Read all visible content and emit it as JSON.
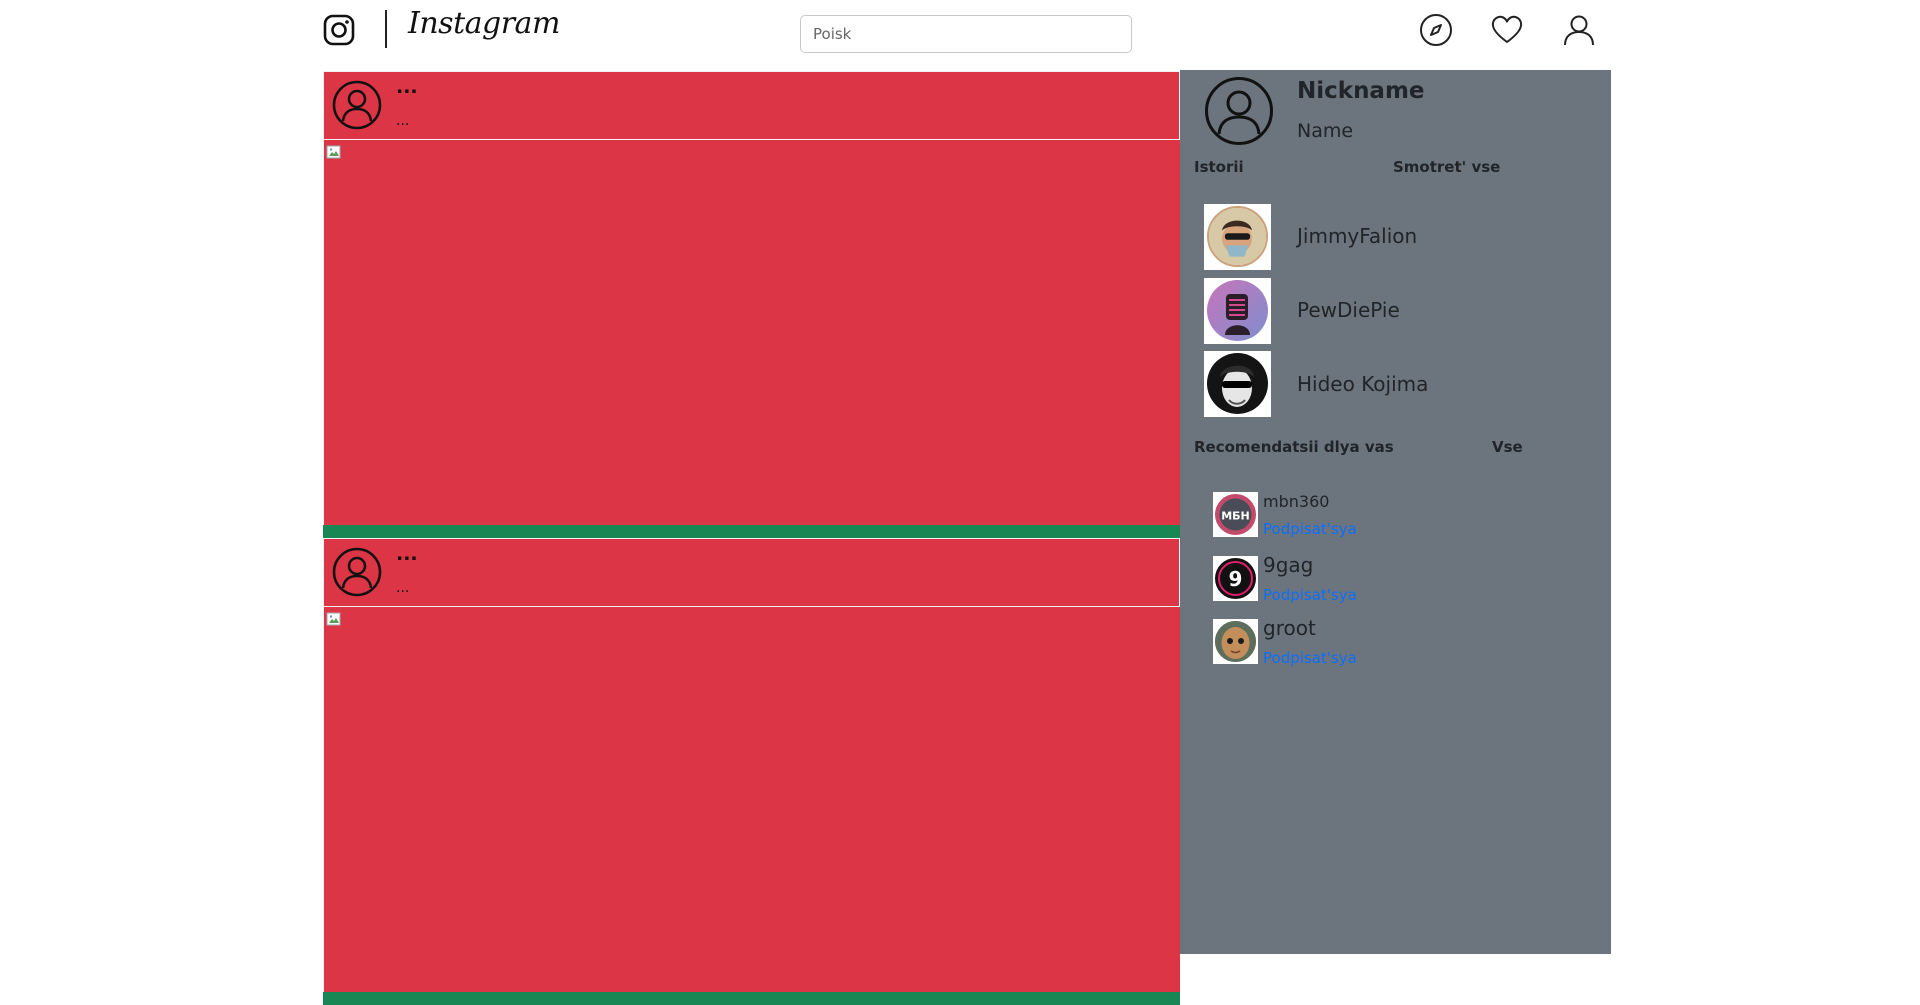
{
  "header": {
    "logo_text": "Instagram",
    "search_placeholder": "Poisk",
    "icons": [
      "instagram-glyph-icon",
      "compass-icon",
      "heart-icon",
      "user-icon"
    ]
  },
  "posts": [
    {
      "username": "...",
      "location": "..."
    },
    {
      "username": "...",
      "location": "..."
    }
  ],
  "sidebar": {
    "nickname": "Nickname",
    "name": "Name",
    "stories_title": "Istorii",
    "stories_link": "Smotret' vse",
    "stories": [
      {
        "name": "JimmyFalion"
      },
      {
        "name": "PewDiePie"
      },
      {
        "name": "Hideo Kojima"
      }
    ],
    "recs_title": "Recomendatsii dlya vas",
    "recs_link": "Vse",
    "recs": [
      {
        "name": "mbn360",
        "follow": "Podpisat'sya",
        "badge": "МБН"
      },
      {
        "name": "9gag",
        "follow": "Podpisat'sya",
        "badge": "9"
      },
      {
        "name": "groot",
        "follow": "Podpisat'sya"
      }
    ]
  },
  "colors": {
    "post_bg": "#dc3545",
    "post_footer": "#198754",
    "sidebar_bg": "#6c757d",
    "link": "#0d6efd"
  }
}
